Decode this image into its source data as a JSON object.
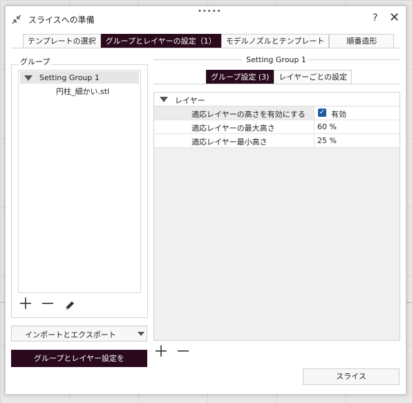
{
  "window": {
    "title": "スライスへの準備",
    "grip": "•••••",
    "help": "?",
    "close": "✕"
  },
  "tabs": [
    {
      "label": "テンプレートの選択",
      "active": false
    },
    {
      "label": "グループとレイヤーの設定（1）",
      "active": true
    },
    {
      "label": "モデルノズルとテンプレート",
      "active": false
    },
    {
      "label": "順番造形",
      "active": false
    }
  ],
  "left": {
    "group_label": "グループ",
    "tree": [
      {
        "label": "Setting Group 1",
        "level": 0,
        "expanded": true,
        "selected": true
      },
      {
        "label": "円柱_細かい.stl",
        "level": 1
      }
    ],
    "icons": [
      "plus-icon",
      "minus-icon",
      "pencil-icon"
    ],
    "dropdown_label": "インポートとエクスポート",
    "apply_button": "グループとレイヤー設定を"
  },
  "right": {
    "group_title": "Setting Group 1",
    "subtabs": [
      {
        "label": "グループ設定 (3)",
        "active": true
      },
      {
        "label": "レイヤーごとの設定",
        "active": false
      }
    ],
    "section": "レイヤー",
    "rows": [
      {
        "name": "適応レイヤーの高さを有効にする",
        "value": "有効",
        "checked": true
      },
      {
        "name": "適応レイヤーの最大高さ",
        "value": "60 %"
      },
      {
        "name": "適応レイヤー最小高さ",
        "value": "25 %"
      }
    ],
    "icons": [
      "plus-icon",
      "minus-icon"
    ]
  },
  "slice_button": "スライス",
  "colors": {
    "accent": "#2a0a1c",
    "checkbox": "#1d5aa6"
  }
}
